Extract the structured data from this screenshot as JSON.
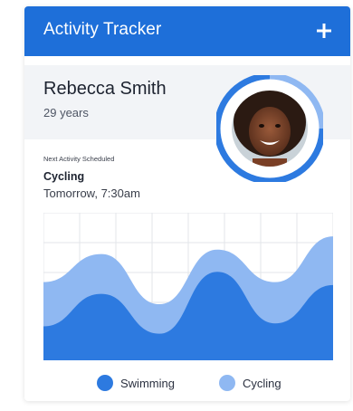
{
  "app": {
    "title": "Activity Tracker"
  },
  "profile": {
    "name": "Rebecca Smith",
    "age": "29 years"
  },
  "next_activity": {
    "label": "Next Activity Scheduled",
    "activity": "Cycling",
    "time": "Tomorrow, 7:30am"
  },
  "icons": {
    "add": "plus-icon",
    "avatar": "user-photo"
  },
  "colors": {
    "header": "#1e6fd9",
    "profile_bg": "#f2f4f7",
    "swimming": "#2d7ae0",
    "cycling": "#8fb8f2",
    "ring_dark": "#2d7ae0",
    "ring_light": "#8fb8f2"
  },
  "chart_data": {
    "type": "area",
    "grid": true,
    "legend_position": "bottom-center",
    "series": [
      {
        "name": "Cycling",
        "values": [
          0.53,
          0.72,
          0.38,
          0.75,
          0.53,
          0.84
        ]
      },
      {
        "name": "Swimming",
        "values": [
          0.23,
          0.45,
          0.18,
          0.6,
          0.25,
          0.51
        ]
      }
    ]
  },
  "legend": {
    "swimming": "Swimming",
    "cycling": "Cycling"
  }
}
